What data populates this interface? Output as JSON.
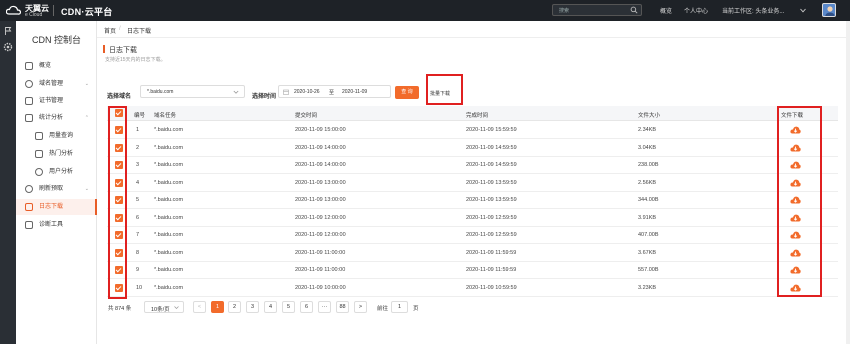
{
  "topbar": {
    "logo_cn": "天翼云",
    "logo_en": "e Cloud",
    "product": "CDN·云平台",
    "search_placeholder": "搜索",
    "links": [
      "概览",
      "个人中心",
      "当前工作区: 头条业务..."
    ]
  },
  "sidebar": {
    "title": "CDN 控制台",
    "items": [
      {
        "label": "概览",
        "icon": "overview-icon"
      },
      {
        "label": "域名管理",
        "icon": "globe-icon",
        "arrow": "⌄"
      },
      {
        "label": "证书管理",
        "icon": "certificate-icon"
      },
      {
        "label": "统计分析",
        "icon": "stats-icon",
        "arrow": "⌃"
      },
      {
        "label": "用量查询",
        "icon": "usage-icon",
        "sub": true
      },
      {
        "label": "热门分析",
        "icon": "hot-icon",
        "sub": true
      },
      {
        "label": "用户分析",
        "icon": "user-icon",
        "sub": true
      },
      {
        "label": "刷新预取",
        "icon": "refresh-icon",
        "arrow": "⌄"
      },
      {
        "label": "日志下载",
        "icon": "log-icon",
        "active": true
      },
      {
        "label": "诊断工具",
        "icon": "tool-icon"
      }
    ]
  },
  "breadcrumb": {
    "home": "首页",
    "sep": "/",
    "current": "日志下载"
  },
  "page": {
    "title": "日志下载",
    "subtitle": "支持近15天内的日志下载。"
  },
  "filters": {
    "domain_label": "选择域名",
    "domain_value": "*.baidu.com",
    "time_label": "选择时间",
    "date_start": "2020-10-26",
    "date_to": "至",
    "date_end": "2020-11-09",
    "query_button": "查 询",
    "batch_button": "批量下载"
  },
  "table": {
    "headers": [
      "编号",
      "域名任务",
      "提交时间",
      "完成时间",
      "文件大小",
      "文件下载"
    ],
    "rows": [
      {
        "no": "1",
        "domain": "*.baidu.com",
        "submit": "2020-11-09 15:00:00",
        "done": "2020-11-09 15:59:59",
        "size": "2.34KB"
      },
      {
        "no": "2",
        "domain": "*.baidu.com",
        "submit": "2020-11-09 14:00:00",
        "done": "2020-11-09 14:59:59",
        "size": "3.04KB"
      },
      {
        "no": "3",
        "domain": "*.baidu.com",
        "submit": "2020-11-09 14:00:00",
        "done": "2020-11-09 14:59:59",
        "size": "238.00B"
      },
      {
        "no": "4",
        "domain": "*.baidu.com",
        "submit": "2020-11-09 13:00:00",
        "done": "2020-11-09 13:59:59",
        "size": "2.56KB"
      },
      {
        "no": "5",
        "domain": "*.baidu.com",
        "submit": "2020-11-09 13:00:00",
        "done": "2020-11-09 13:59:59",
        "size": "344.00B"
      },
      {
        "no": "6",
        "domain": "*.baidu.com",
        "submit": "2020-11-09 12:00:00",
        "done": "2020-11-09 12:59:59",
        "size": "3.91KB"
      },
      {
        "no": "7",
        "domain": "*.baidu.com",
        "submit": "2020-11-09 12:00:00",
        "done": "2020-11-09 12:59:59",
        "size": "407.00B"
      },
      {
        "no": "8",
        "domain": "*.baidu.com",
        "submit": "2020-11-09 11:00:00",
        "done": "2020-11-09 11:59:59",
        "size": "3.67KB"
      },
      {
        "no": "9",
        "domain": "*.baidu.com",
        "submit": "2020-11-09 11:00:00",
        "done": "2020-11-09 11:59:59",
        "size": "557.00B"
      },
      {
        "no": "10",
        "domain": "*.baidu.com",
        "submit": "2020-11-09 10:00:00",
        "done": "2020-11-09 10:59:59",
        "size": "3.23KB"
      }
    ]
  },
  "pagination": {
    "total": "共 874 条",
    "page_size": "10条/页",
    "prev": "<",
    "pages": [
      "1",
      "2",
      "3",
      "4",
      "5",
      "6",
      "···",
      "88"
    ],
    "next": ">",
    "goto_label": "前往",
    "goto_value": "1",
    "goto_unit": "页"
  },
  "colors": {
    "accent": "#f26b2b",
    "highlight_box": "#e02020",
    "topbar": "#1e2227"
  }
}
